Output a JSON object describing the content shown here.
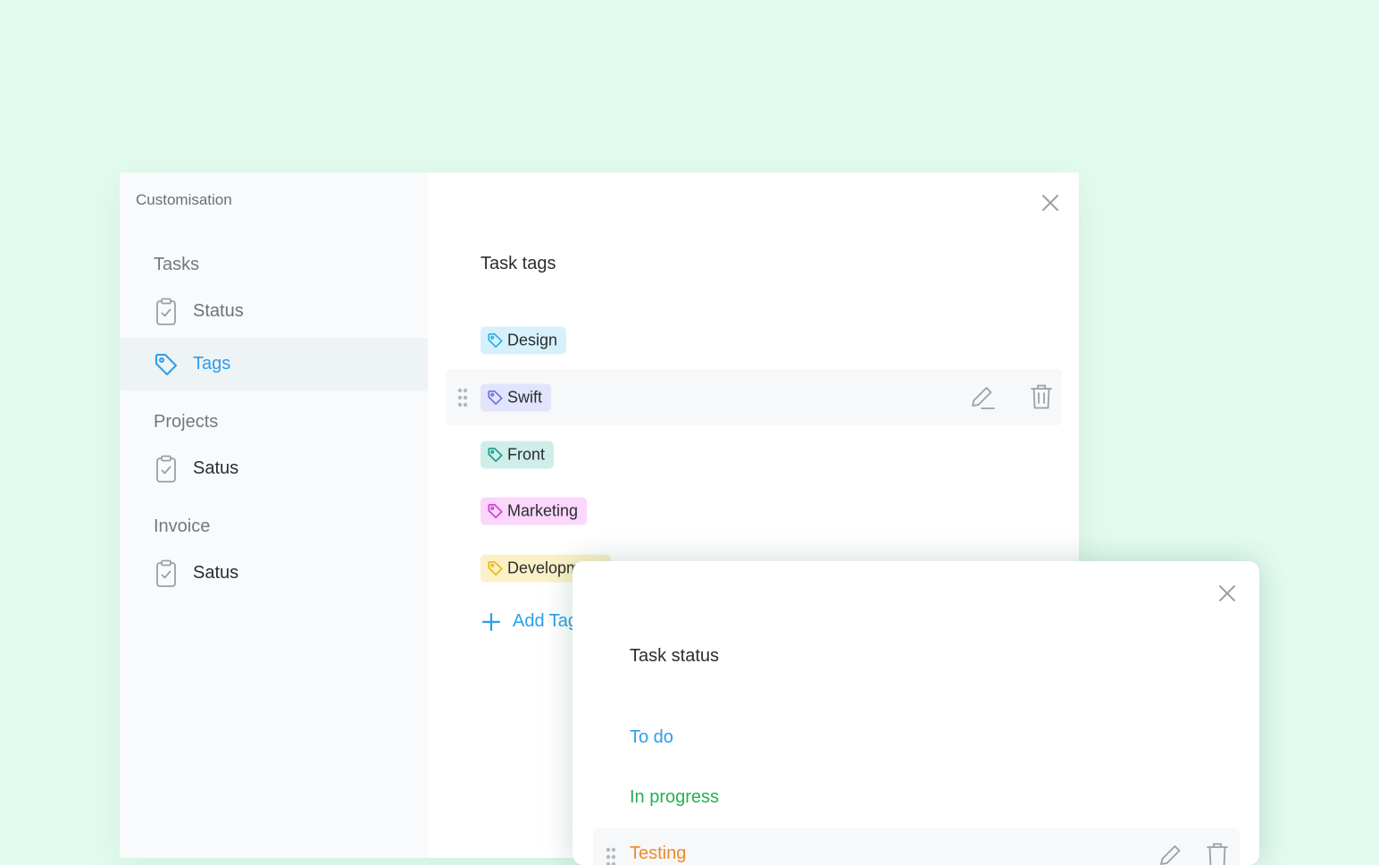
{
  "sidebar": {
    "title": "Customisation",
    "sections": [
      {
        "label": "Tasks",
        "items": [
          {
            "label": "Status"
          },
          {
            "label": "Tags"
          }
        ]
      },
      {
        "label": "Projects",
        "items": [
          {
            "label": "Satus"
          }
        ]
      },
      {
        "label": "Invoice",
        "items": [
          {
            "label": "Satus"
          }
        ]
      }
    ]
  },
  "tags_panel": {
    "title": "Task tags",
    "tags": [
      {
        "label": "Design",
        "color": "#29aee8",
        "bg": "#d7f1fc"
      },
      {
        "label": "Swift",
        "color": "#6a73e0",
        "bg": "#e2e4fb"
      },
      {
        "label": "Front",
        "color": "#1e9c8a",
        "bg": "#cfeee9"
      },
      {
        "label": "Marketing",
        "color": "#d43ad8",
        "bg": "#fad7fb"
      },
      {
        "label": "Development",
        "color": "#e8b814",
        "bg": "#fbf1c8"
      }
    ],
    "add_label": "Add Tag"
  },
  "status_panel": {
    "title": "Task status",
    "statuses": [
      {
        "label": "To do",
        "color": "#2b9ee8"
      },
      {
        "label": "In progress",
        "color": "#25b04f"
      },
      {
        "label": "Testing",
        "color": "#f08a2a"
      }
    ]
  },
  "colors": {
    "background": "#e3fbef",
    "accent": "#2b9ee8"
  }
}
